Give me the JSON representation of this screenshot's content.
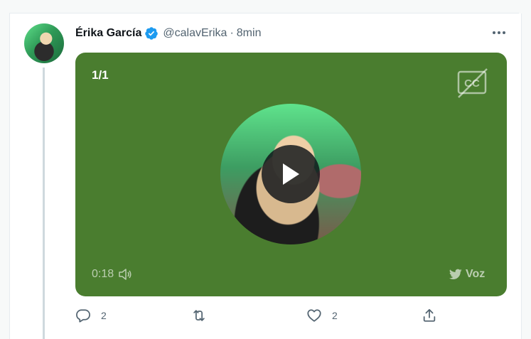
{
  "tweet": {
    "author_name": "Érika García",
    "handle": "@calavErika",
    "separator": "·",
    "time": "8min",
    "verified_icon": "verified-badge-icon",
    "more_icon": "more-horizontal-icon"
  },
  "media": {
    "counter": "1/1",
    "duration": "0:18",
    "voice_label": "Voz",
    "background_color": "#4a7d2f",
    "cc_icon": "closed-captions-off-icon",
    "play_icon": "play-icon",
    "volume_icon": "volume-icon",
    "voice_icon": "twitter-bird-icon"
  },
  "actions": {
    "reply_count": "2",
    "like_count": "2",
    "reply_icon": "reply-icon",
    "retweet_icon": "retweet-icon",
    "like_icon": "heart-icon",
    "share_icon": "share-icon"
  },
  "colors": {
    "verified": "#1d9bf0",
    "text_secondary": "#536471"
  }
}
